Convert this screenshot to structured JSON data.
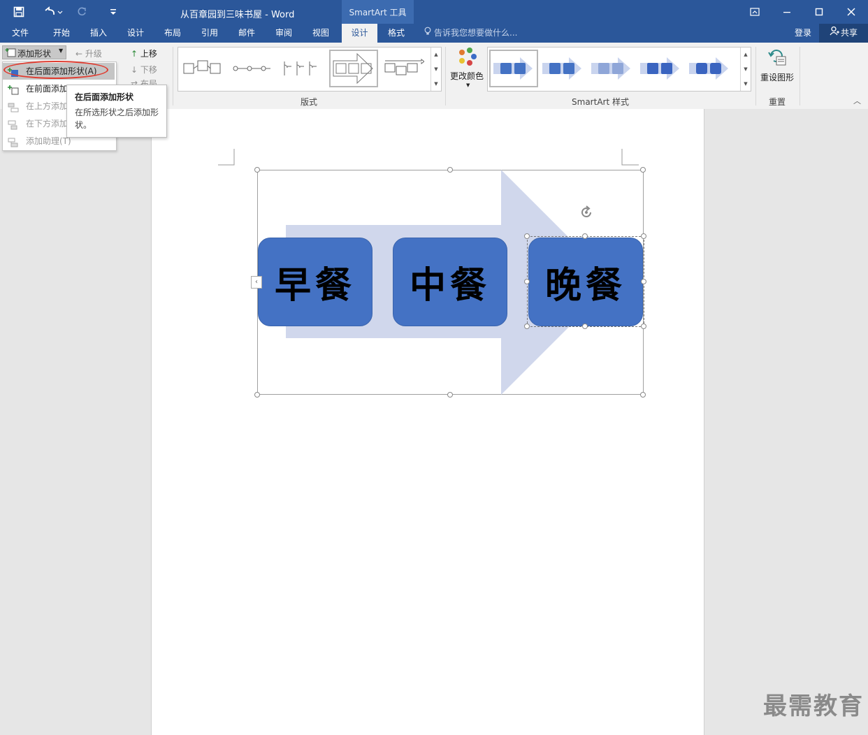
{
  "window": {
    "doc_title": "从百章园到三味书屋 - Word",
    "context_tab_title": "SmartArt 工具"
  },
  "tabs": [
    {
      "label": "文件"
    },
    {
      "label": "开始"
    },
    {
      "label": "插入"
    },
    {
      "label": "设计"
    },
    {
      "label": "布局"
    },
    {
      "label": "引用"
    },
    {
      "label": "邮件"
    },
    {
      "label": "审阅"
    },
    {
      "label": "视图"
    },
    {
      "label": "设计"
    },
    {
      "label": "格式"
    }
  ],
  "tell_me": "告诉我您想要做什么...",
  "account": {
    "login": "登录",
    "share": "共享"
  },
  "ribbon": {
    "create_graphic": {
      "add_shape": "添加形状",
      "promote": "升级",
      "move_up": "上移",
      "move_down": "下移",
      "layout_cut": "布局"
    },
    "layouts_label": "版式",
    "change_colors": "更改颜色",
    "styles_label": "SmartArt 样式",
    "reset_graphic": "重设图形",
    "reset_label": "重置"
  },
  "dropdown": {
    "items": [
      {
        "label": "在后面添加形状(A)"
      },
      {
        "label": "在前面添加"
      },
      {
        "label": "在上方添加"
      },
      {
        "label": "在下方添加"
      },
      {
        "label": "添加助理(T)"
      }
    ]
  },
  "tooltip": {
    "title": "在后面添加形状",
    "desc": "在所选形状之后添加形状。"
  },
  "smartart": {
    "shapes": [
      {
        "text": "早餐"
      },
      {
        "text": "中餐"
      },
      {
        "text": "晚餐"
      }
    ],
    "colors": {
      "fill": "#4472c4",
      "arrow": "#d0d7ec"
    }
  },
  "watermark": "最需教育",
  "colors": {
    "title_bar": "#2b579a",
    "ribbon": "#f1f1f1"
  }
}
